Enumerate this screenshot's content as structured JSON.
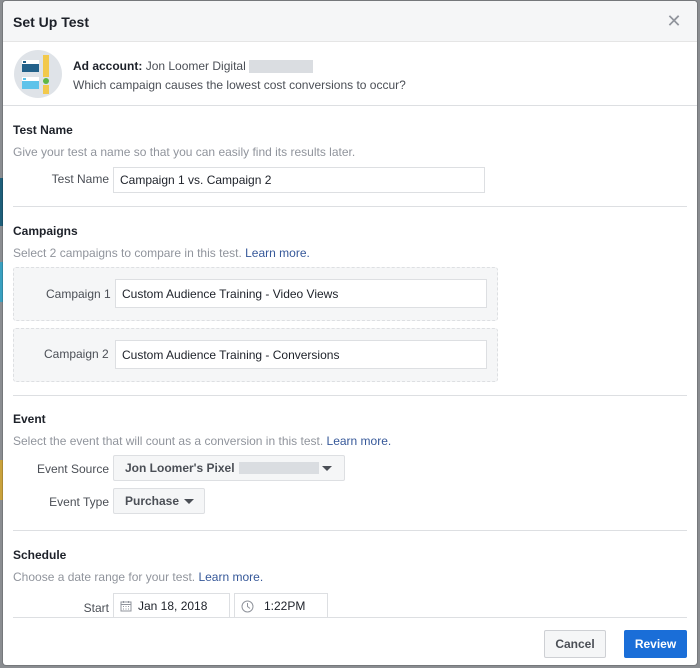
{
  "dialog": {
    "title": "Set Up Test",
    "close_icon": "close-icon"
  },
  "intro": {
    "ad_account_label": "Ad account:",
    "ad_account_name": "Jon Loomer Digital",
    "question": "Which campaign causes the lowest cost conversions to occur?"
  },
  "test_name": {
    "title": "Test Name",
    "description": "Give your test a name so that you can easily find its results later.",
    "field_label": "Test Name",
    "field_value": "Campaign 1 vs. Campaign 2"
  },
  "campaigns": {
    "title": "Campaigns",
    "description": "Select 2 campaigns to compare in this test.",
    "learn_more": "Learn more.",
    "items": [
      {
        "label": "Campaign 1",
        "value": "Custom Audience Training - Video Views"
      },
      {
        "label": "Campaign 2",
        "value": "Custom Audience Training -  Conversions"
      }
    ]
  },
  "event": {
    "title": "Event",
    "description": "Select the event that will count as a conversion in this test.",
    "learn_more": "Learn more.",
    "source_label": "Event Source",
    "source_value": "Jon Loomer's Pixel",
    "type_label": "Event Type",
    "type_value": "Purchase"
  },
  "schedule": {
    "title": "Schedule",
    "description": "Choose a date range for your test.",
    "learn_more": "Learn more.",
    "start_label": "Start",
    "start_date": "Jan 18, 2018",
    "start_time": "1:22PM"
  },
  "footer": {
    "cancel_label": "Cancel",
    "review_label": "Review"
  },
  "colors": {
    "primary": "#1a6ed8",
    "link": "#365899",
    "header_bg": "#f5f6f7"
  }
}
